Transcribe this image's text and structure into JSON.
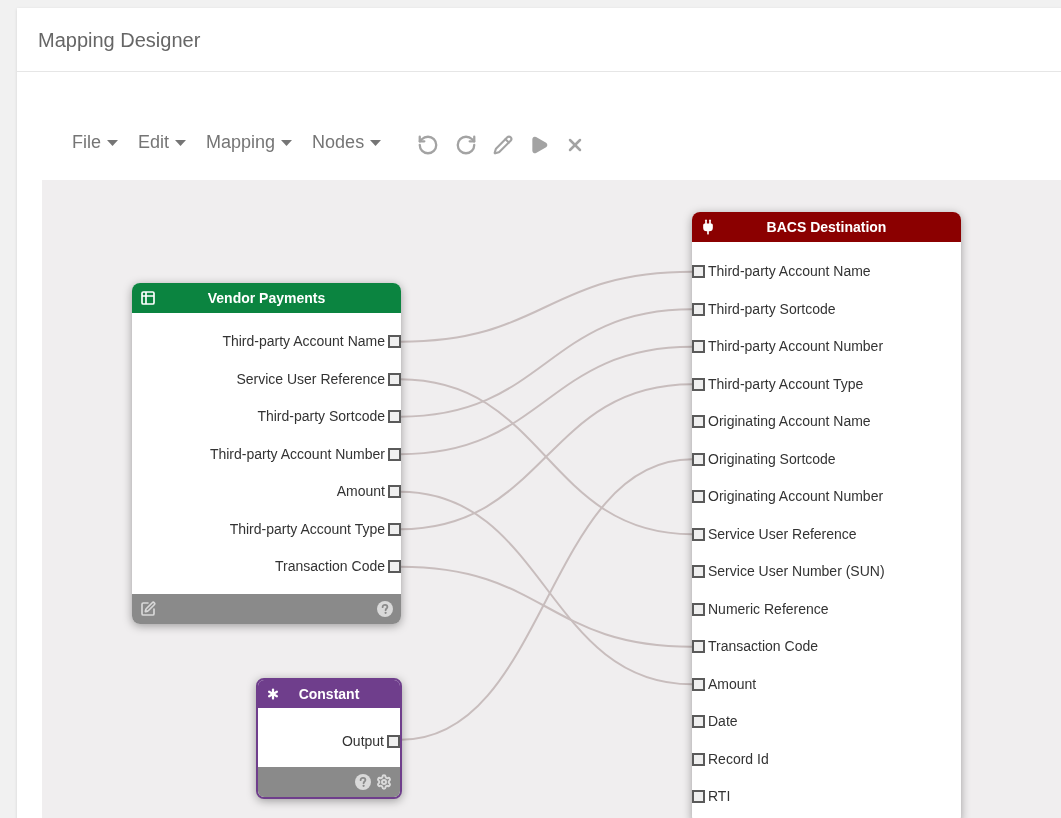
{
  "window": {
    "title": "Mapping Designer"
  },
  "menus": [
    {
      "label": "File"
    },
    {
      "label": "Edit"
    },
    {
      "label": "Mapping"
    },
    {
      "label": "Nodes"
    }
  ],
  "nodes": [
    {
      "kind": "source",
      "title": "Vendor Payments",
      "ports": [
        "Third-party Account Name",
        "Service User Reference",
        "Third-party Sortcode",
        "Third-party Account Number",
        "Amount",
        "Third-party Account Type",
        "Transaction Code"
      ]
    },
    {
      "kind": "constant",
      "title": "Constant",
      "ports": [
        "Output"
      ]
    },
    {
      "kind": "destination",
      "title": "BACS Destination",
      "ports": [
        "Third-party Account Name",
        "Third-party Sortcode",
        "Third-party Account Number",
        "Third-party Account Type",
        "Originating Account Name",
        "Originating Sortcode",
        "Originating Account Number",
        "Service User Reference",
        "Service User Number (SUN)",
        "Numeric Reference",
        "Transaction Code",
        "Amount",
        "Date",
        "Record Id",
        "RTI"
      ]
    }
  ]
}
